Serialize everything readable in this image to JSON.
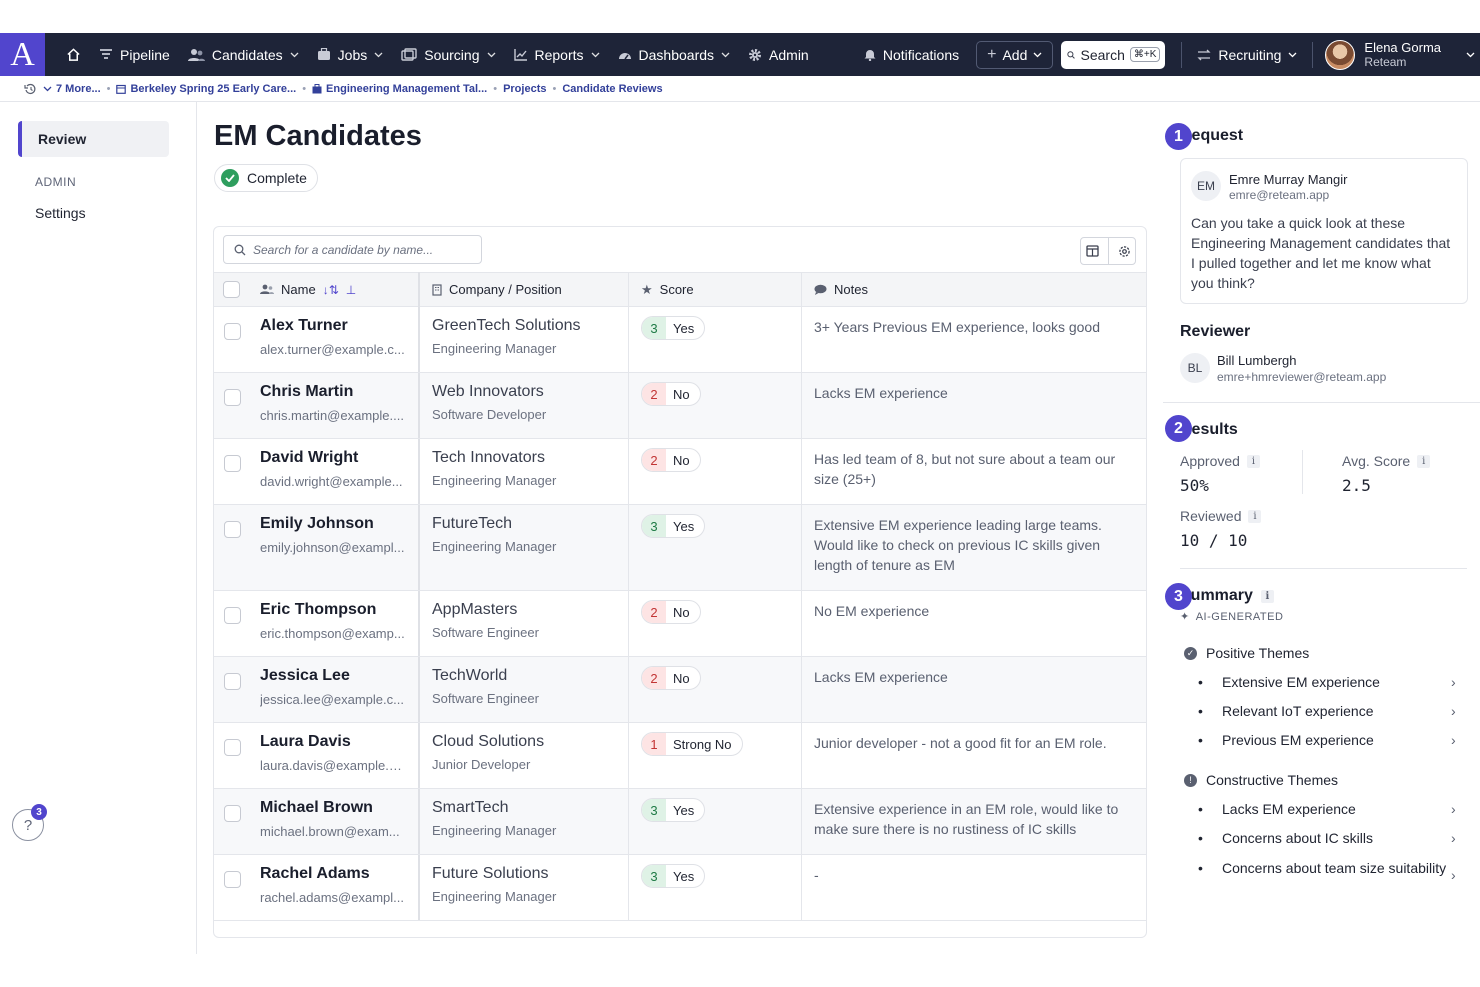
{
  "nav": {
    "logo": "A",
    "items": [
      {
        "label": "Pipeline",
        "icon": "filter-icon",
        "dropdown": false
      },
      {
        "label": "Candidates",
        "icon": "people-icon",
        "dropdown": true
      },
      {
        "label": "Jobs",
        "icon": "briefcase-icon",
        "dropdown": true
      },
      {
        "label": "Sourcing",
        "icon": "sourcing-icon",
        "dropdown": true
      },
      {
        "label": "Reports",
        "icon": "chart-icon",
        "dropdown": true
      },
      {
        "label": "Dashboards",
        "icon": "gauge-icon",
        "dropdown": true
      },
      {
        "label": "Admin",
        "icon": "gear-icon",
        "dropdown": false
      }
    ],
    "notifications": "Notifications",
    "add": "Add",
    "search": "Search",
    "search_shortcut": "⌘+K",
    "recruiting": "Recruiting",
    "user_name": "Elena Gorma",
    "user_org": "Reteam"
  },
  "breadcrumbs": {
    "more": "7 More...",
    "items": [
      "Berkeley Spring 25 Early Care...",
      "Engineering Management Tal...",
      "Projects",
      "Candidate Reviews"
    ]
  },
  "sidebar": {
    "active": "Review",
    "section": "ADMIN",
    "settings": "Settings",
    "help_badge": "3"
  },
  "main": {
    "title": "EM Candidates",
    "status": "Complete",
    "search_placeholder": "Search for a candidate by name...",
    "columns": {
      "name": "Name",
      "company": "Company / Position",
      "score": "Score",
      "notes": "Notes"
    },
    "rows": [
      {
        "name": "Alex Turner",
        "email": "alex.turner@example.c...",
        "company": "GreenTech Solutions",
        "position": "Engineering Manager",
        "score": "3",
        "verdict": "Yes",
        "tone": "g",
        "notes": "3+ Years Previous EM experience, looks good"
      },
      {
        "name": "Chris Martin",
        "email": "chris.martin@example....",
        "company": "Web Innovators",
        "position": "Software Developer",
        "score": "2",
        "verdict": "No",
        "tone": "r",
        "notes": "Lacks EM experience"
      },
      {
        "name": "David Wright",
        "email": "david.wright@example...",
        "company": "Tech Innovators",
        "position": "Engineering Manager",
        "score": "2",
        "verdict": "No",
        "tone": "r",
        "notes": "Has led team of 8, but not sure about a team our size (25+)"
      },
      {
        "name": "Emily Johnson",
        "email": "emily.johnson@exampl...",
        "company": "FutureTech",
        "position": "Engineering Manager",
        "score": "3",
        "verdict": "Yes",
        "tone": "g",
        "notes": "Extensive EM experience leading large teams. Would like to check on previous IC skills given length of tenure as EM"
      },
      {
        "name": "Eric Thompson",
        "email": "eric.thompson@examp...",
        "company": "AppMasters",
        "position": "Software Engineer",
        "score": "2",
        "verdict": "No",
        "tone": "r",
        "notes": "No EM experience"
      },
      {
        "name": "Jessica Lee",
        "email": "jessica.lee@example.c...",
        "company": "TechWorld",
        "position": "Software Engineer",
        "score": "2",
        "verdict": "No",
        "tone": "r",
        "notes": "Lacks EM experience"
      },
      {
        "name": "Laura Davis",
        "email": "laura.davis@example.c...",
        "company": "Cloud Solutions",
        "position": "Junior Developer",
        "score": "1",
        "verdict": "Strong No",
        "tone": "r",
        "notes": "Junior developer - not a good fit for an EM role."
      },
      {
        "name": "Michael Brown",
        "email": "michael.brown@exam...",
        "company": "SmartTech",
        "position": "Engineering Manager",
        "score": "3",
        "verdict": "Yes",
        "tone": "g",
        "notes": "Extensive experience in an EM role, would like to make sure there is no rustiness of IC skills"
      },
      {
        "name": "Rachel Adams",
        "email": "rachel.adams@exampl...",
        "company": "Future Solutions",
        "position": "Engineering Manager",
        "score": "3",
        "verdict": "Yes",
        "tone": "g",
        "notes": "-"
      }
    ]
  },
  "right": {
    "request": {
      "num": "1",
      "title": "Request",
      "initials": "EM",
      "name": "Emre Murray Mangir",
      "email": "emre@reteam.app",
      "message": "Can you take a quick look at these Engineering Management candidates that I pulled together and let me know what you think?"
    },
    "reviewer": {
      "title": "Reviewer",
      "initials": "BL",
      "name": "Bill Lumbergh",
      "email": "emre+hmreviewer@reteam.app"
    },
    "results": {
      "num": "2",
      "title": "Results",
      "approved_label": "Approved",
      "approved_value": "50%",
      "avg_label": "Avg. Score",
      "avg_value": "2.5",
      "reviewed_label": "Reviewed",
      "reviewed_value": "10 / 10"
    },
    "summary": {
      "num": "3",
      "title": "Summary",
      "ai_label": "AI-GENERATED",
      "positive_title": "Positive Themes",
      "positive": [
        "Extensive EM experience",
        "Relevant IoT experience",
        "Previous EM experience"
      ],
      "constructive_title": "Constructive Themes",
      "constructive": [
        "Lacks EM experience",
        "Concerns about IC skills",
        "Concerns about team size suitability"
      ]
    }
  }
}
